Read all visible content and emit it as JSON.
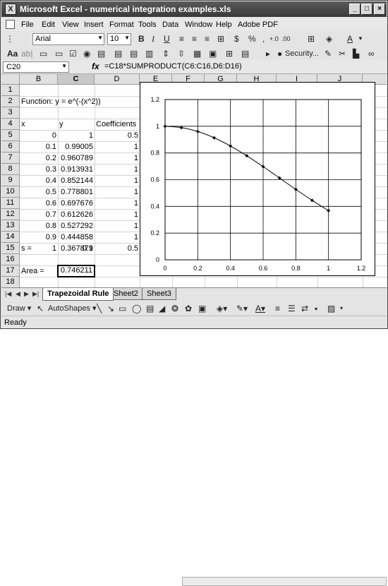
{
  "window": {
    "title": "Microsoft Excel - numerical integration examples.xls"
  },
  "menu": [
    "File",
    "Edit",
    "View",
    "Insert",
    "Format",
    "Tools",
    "Data",
    "Window",
    "Help",
    "Adobe PDF"
  ],
  "toolbar": {
    "font_name": "Arial",
    "font_size": "10",
    "security_label": "Security..."
  },
  "formula_bar": {
    "name_box": "C20",
    "fx": "fx",
    "formula": "=C18*SUMPRODUCT(C6:C16,D6:D16)"
  },
  "columns": [
    "A",
    "B",
    "C",
    "D",
    "E",
    "F",
    "G",
    "H",
    "I",
    "J"
  ],
  "rows": [
    "1",
    "2",
    "3",
    "4",
    "5",
    "6",
    "7",
    "8",
    "9",
    "10",
    "11",
    "12",
    "13",
    "14",
    "15",
    "16",
    "17",
    "18",
    "19",
    "20",
    "21"
  ],
  "sheet": {
    "function_label": "Function: y = e^(-(x^2))",
    "headers": {
      "x": "x",
      "y": "y",
      "coeff": "Coefficients"
    },
    "x_values": [
      "0",
      "0.1",
      "0.2",
      "0.3",
      "0.4",
      "0.5",
      "0.6",
      "0.7",
      "0.8",
      "0.9",
      "1"
    ],
    "y_values": [
      "1",
      "0.99005",
      "0.960789",
      "0.913931",
      "0.852144",
      "0.778801",
      "0.697676",
      "0.612626",
      "0.527292",
      "0.444858",
      "0.367879"
    ],
    "coefficients": [
      "0.5",
      "1",
      "1",
      "1",
      "1",
      "1",
      "1",
      "1",
      "1",
      "1",
      "0.5"
    ],
    "s_label": "s =",
    "s_value": "0.1",
    "area_label": "Area =",
    "area_value": "0.746211"
  },
  "chart_data": {
    "type": "scatter",
    "x": [
      0,
      0.1,
      0.2,
      0.3,
      0.4,
      0.5,
      0.6,
      0.7,
      0.8,
      0.9,
      1
    ],
    "y": [
      1,
      0.99005,
      0.960789,
      0.913931,
      0.852144,
      0.778801,
      0.697676,
      0.612626,
      0.527292,
      0.444858,
      0.367879
    ],
    "xlim": [
      0,
      1.2
    ],
    "ylim": [
      0,
      1.2
    ],
    "x_ticks": [
      "0",
      "0.2",
      "0.4",
      "0.6",
      "0.8",
      "1",
      "1.2"
    ],
    "y_ticks": [
      "0",
      "0.2",
      "0.4",
      "0.6",
      "0.8",
      "1",
      "1.2"
    ],
    "grid": true,
    "marker": "diamond",
    "line": "smoothed",
    "color": "#000000"
  },
  "tabs": [
    "Trapezoidal Rule",
    "Sheet2",
    "Sheet3"
  ],
  "active_tab": "Trapezoidal Rule",
  "drawing_toolbar": {
    "draw_label": "Draw",
    "autoshapes_label": "AutoShapes"
  },
  "status": "Ready"
}
